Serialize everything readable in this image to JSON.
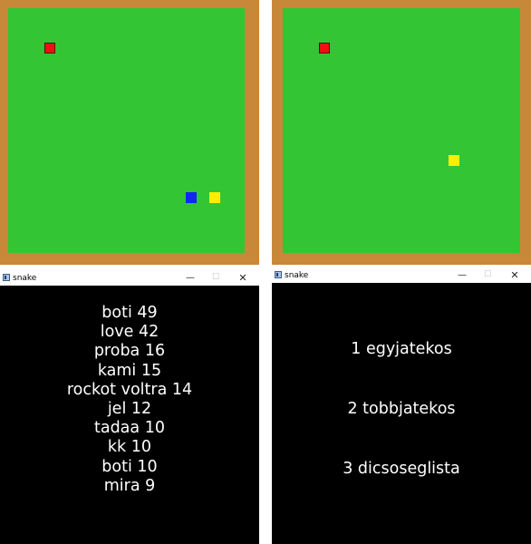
{
  "game_left": {
    "colors": {
      "border": "#c8883a",
      "field": "#33c533"
    },
    "food": {
      "color": "red"
    },
    "snake_blue": {
      "color": "blue"
    },
    "snake_yellow": {
      "color": "yellow"
    }
  },
  "game_right": {
    "colors": {
      "border": "#c8883a",
      "field": "#33c533"
    },
    "food": {
      "color": "red"
    },
    "snake_yellow": {
      "color": "yellow"
    }
  },
  "highscore_window": {
    "title": "snake",
    "controls": {
      "minimize": "—",
      "maximize": "☐",
      "close": "✕"
    },
    "scores": [
      {
        "name": "boti",
        "score": 49
      },
      {
        "name": "love",
        "score": 42
      },
      {
        "name": "proba",
        "score": 16
      },
      {
        "name": "kami",
        "score": 15
      },
      {
        "name": "rockot voltra",
        "score": 14
      },
      {
        "name": "jel",
        "score": 12
      },
      {
        "name": "tadaa",
        "score": 10
      },
      {
        "name": "kk",
        "score": 10
      },
      {
        "name": "boti",
        "score": 10
      },
      {
        "name": "mira",
        "score": 9
      }
    ]
  },
  "menu_window": {
    "title": "snake",
    "controls": {
      "minimize": "—",
      "maximize": "☐",
      "close": "✕"
    },
    "menu": [
      {
        "label": "1 egyjatekos"
      },
      {
        "label": "2 tobbjatekos"
      },
      {
        "label": "3 dicsoseglista"
      }
    ]
  }
}
